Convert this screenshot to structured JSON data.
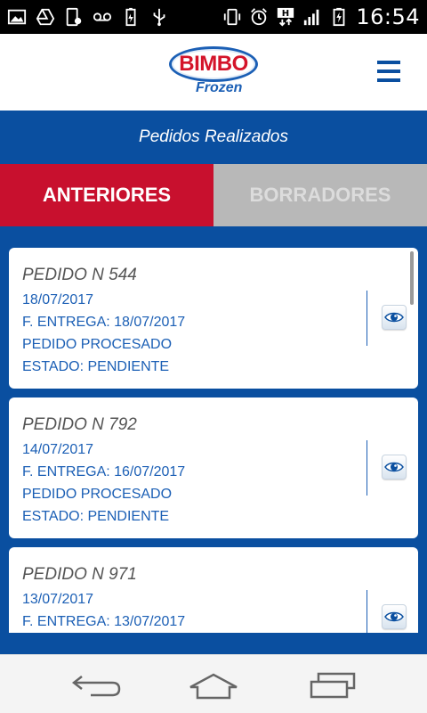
{
  "status_bar": {
    "time": "16:54",
    "network_type": "H",
    "icons": [
      "image-icon",
      "drive-icon",
      "phone-settings-icon",
      "voicemail-icon",
      "battery-saver-icon",
      "usb-icon",
      "vibrate-icon",
      "alarm-icon",
      "network-type-icon",
      "signal-icon",
      "battery-charging-icon"
    ]
  },
  "header": {
    "logo_text": "BIMBO",
    "logo_sub": "Frozen",
    "menu_icon": "hamburger-menu-icon"
  },
  "page": {
    "title": "Pedidos Realizados"
  },
  "tabs": [
    {
      "label": "ANTERIORES",
      "active": true
    },
    {
      "label": "BORRADORES",
      "active": false
    }
  ],
  "orders": [
    {
      "title": "PEDIDO N 544",
      "date": "18/07/2017",
      "delivery": "F. ENTREGA: 18/07/2017",
      "status": "PEDIDO PROCESADO",
      "state": "ESTADO: PENDIENTE"
    },
    {
      "title": "PEDIDO N 792",
      "date": "14/07/2017",
      "delivery": "F. ENTREGA: 16/07/2017",
      "status": "PEDIDO PROCESADO",
      "state": "ESTADO: PENDIENTE"
    },
    {
      "title": "PEDIDO N 971",
      "date": "13/07/2017",
      "delivery": "F. ENTREGA: 13/07/2017",
      "status": "",
      "state": ""
    }
  ],
  "colors": {
    "brand_blue": "#0a4fa0",
    "active_tab": "#c8102e",
    "inactive_tab": "#b8b8b8",
    "text_blue": "#1b5fb5"
  },
  "navbar": {
    "icons": [
      "back-icon",
      "home-icon",
      "recent-apps-icon"
    ]
  }
}
